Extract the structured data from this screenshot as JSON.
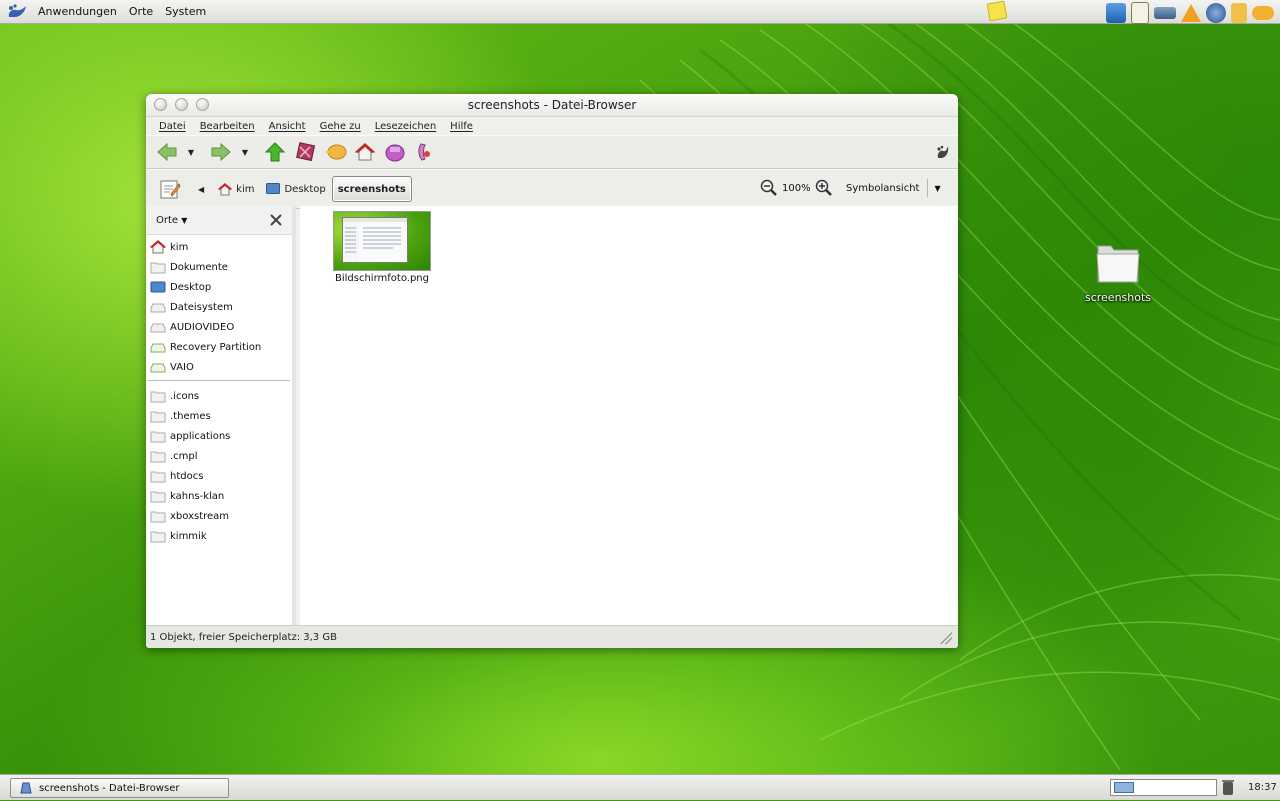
{
  "top_panel": {
    "menus": [
      "Anwendungen",
      "Orte",
      "System"
    ]
  },
  "desktop": {
    "icon_label": "screenshots"
  },
  "window": {
    "title": "screenshots - Datei-Browser",
    "menubar": [
      "Datei",
      "Bearbeiten",
      "Ansicht",
      "Gehe zu",
      "Lesezeichen",
      "Hilfe"
    ],
    "breadcrumbs": {
      "home": "kim",
      "desktop": "Desktop",
      "current": "screenshots"
    },
    "zoom_level": "100%",
    "view_mode": "Symbolansicht",
    "sidebar": {
      "header": "Orte",
      "places": [
        "kim",
        "Dokumente",
        "Desktop",
        "Dateisystem",
        "AUDIOVIDEO",
        "Recovery Partition",
        "VAIO"
      ],
      "bookmarks": [
        ".icons",
        ".themes",
        "applications",
        ".cmpl",
        "htdocs",
        "kahns-klan",
        "xboxstream",
        "kimmik"
      ]
    },
    "files": [
      {
        "name": "Bildschirmfoto.png"
      }
    ],
    "status": "1 Objekt, freier Speicherplatz: 3,3 GB"
  },
  "taskbar": {
    "task_label": "screenshots - Datei-Browser",
    "clock": "18:37"
  },
  "colors": {
    "accent_green": "#5cb514",
    "home_red": "#c0282a",
    "up_green": "#3aa624"
  }
}
